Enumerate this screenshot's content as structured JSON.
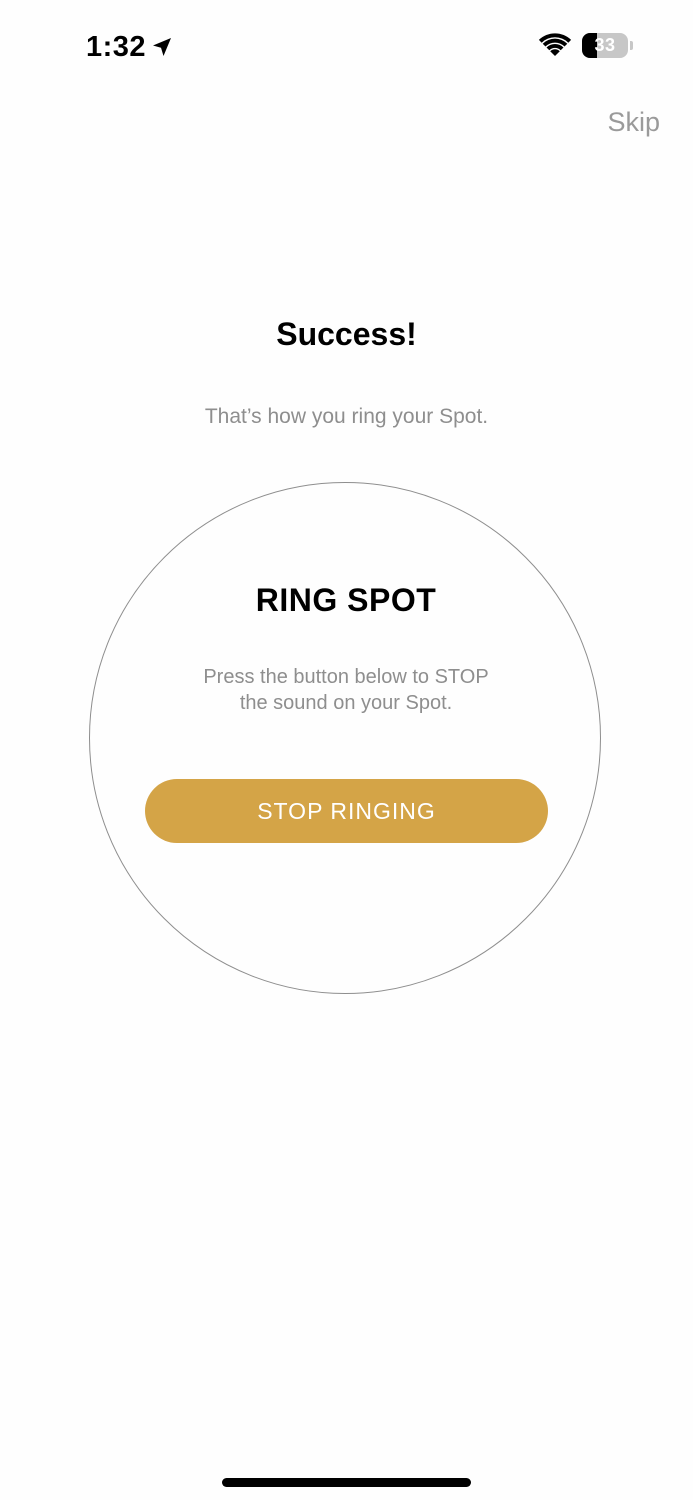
{
  "status_bar": {
    "time": "1:32",
    "battery_level": "33",
    "battery_fraction": 0.33,
    "icons": [
      "location-arrow-icon",
      "wifi-icon",
      "battery-icon"
    ]
  },
  "header": {
    "skip_label": "Skip"
  },
  "main": {
    "title": "Success!",
    "subtitle": "That’s how you ring your Spot."
  },
  "ring_panel": {
    "title": "RING SPOT",
    "instructions_line1": "Press the button below to STOP",
    "instructions_line2": "the sound on your Spot.",
    "button_label": "STOP RINGING"
  },
  "colors": {
    "accent": "#d4a447",
    "muted_text": "#8e8e8e",
    "background": "#fefefe"
  }
}
